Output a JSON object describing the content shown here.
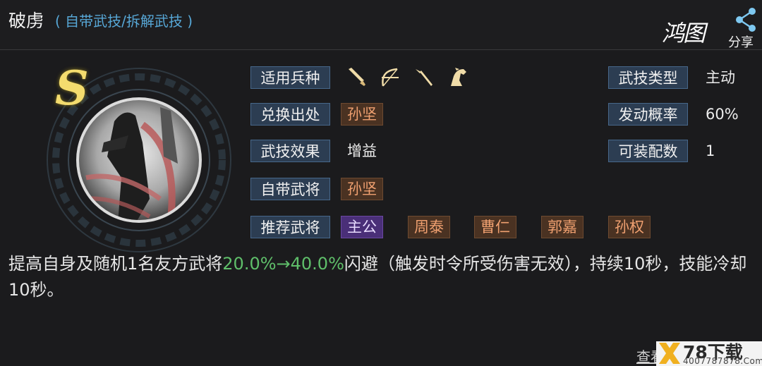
{
  "header": {
    "title": "破虏",
    "subtitle": "( 自带武技/拆解武技 )",
    "brand": "鸿图",
    "share_label": "分享"
  },
  "skill": {
    "grade": "S",
    "unit_icons": [
      "sword-icon",
      "bow-icon",
      "spear-icon",
      "horse-icon"
    ],
    "rows": {
      "troop_label": "适用兵种",
      "source_label": "兑换出处",
      "source_value": "孙坚",
      "effect_label": "武技效果",
      "effect_value": "增益",
      "innate_label": "自带武将",
      "innate_value": "孙坚",
      "recommend_label": "推荐武将",
      "recommend": [
        "主公",
        "周泰",
        "曹仁",
        "郭嘉",
        "孙权"
      ]
    },
    "right": {
      "type_label": "武技类型",
      "type_value": "主动",
      "rate_label": "发动概率",
      "rate_value": "60%",
      "slots_label": "可装配数",
      "slots_value": "1"
    },
    "description": {
      "before": "提高自身及随机1名友方武将",
      "highlight": "20.0%→40.0%",
      "after": "闪避（触发时令所受伤害无效），持续10秒，技能冷却10秒。"
    }
  },
  "footer": {
    "link": "查看",
    "watermark_title": "78下载",
    "watermark_url": "4007787878.Com"
  },
  "colors": {
    "label_bg": "#2c3d52",
    "tag_bg": "#4a3222",
    "tag_text": "#f0a070",
    "highlight": "#5fbf6a",
    "subtitle": "#57a7d6",
    "grade": "#f4dc6e"
  }
}
